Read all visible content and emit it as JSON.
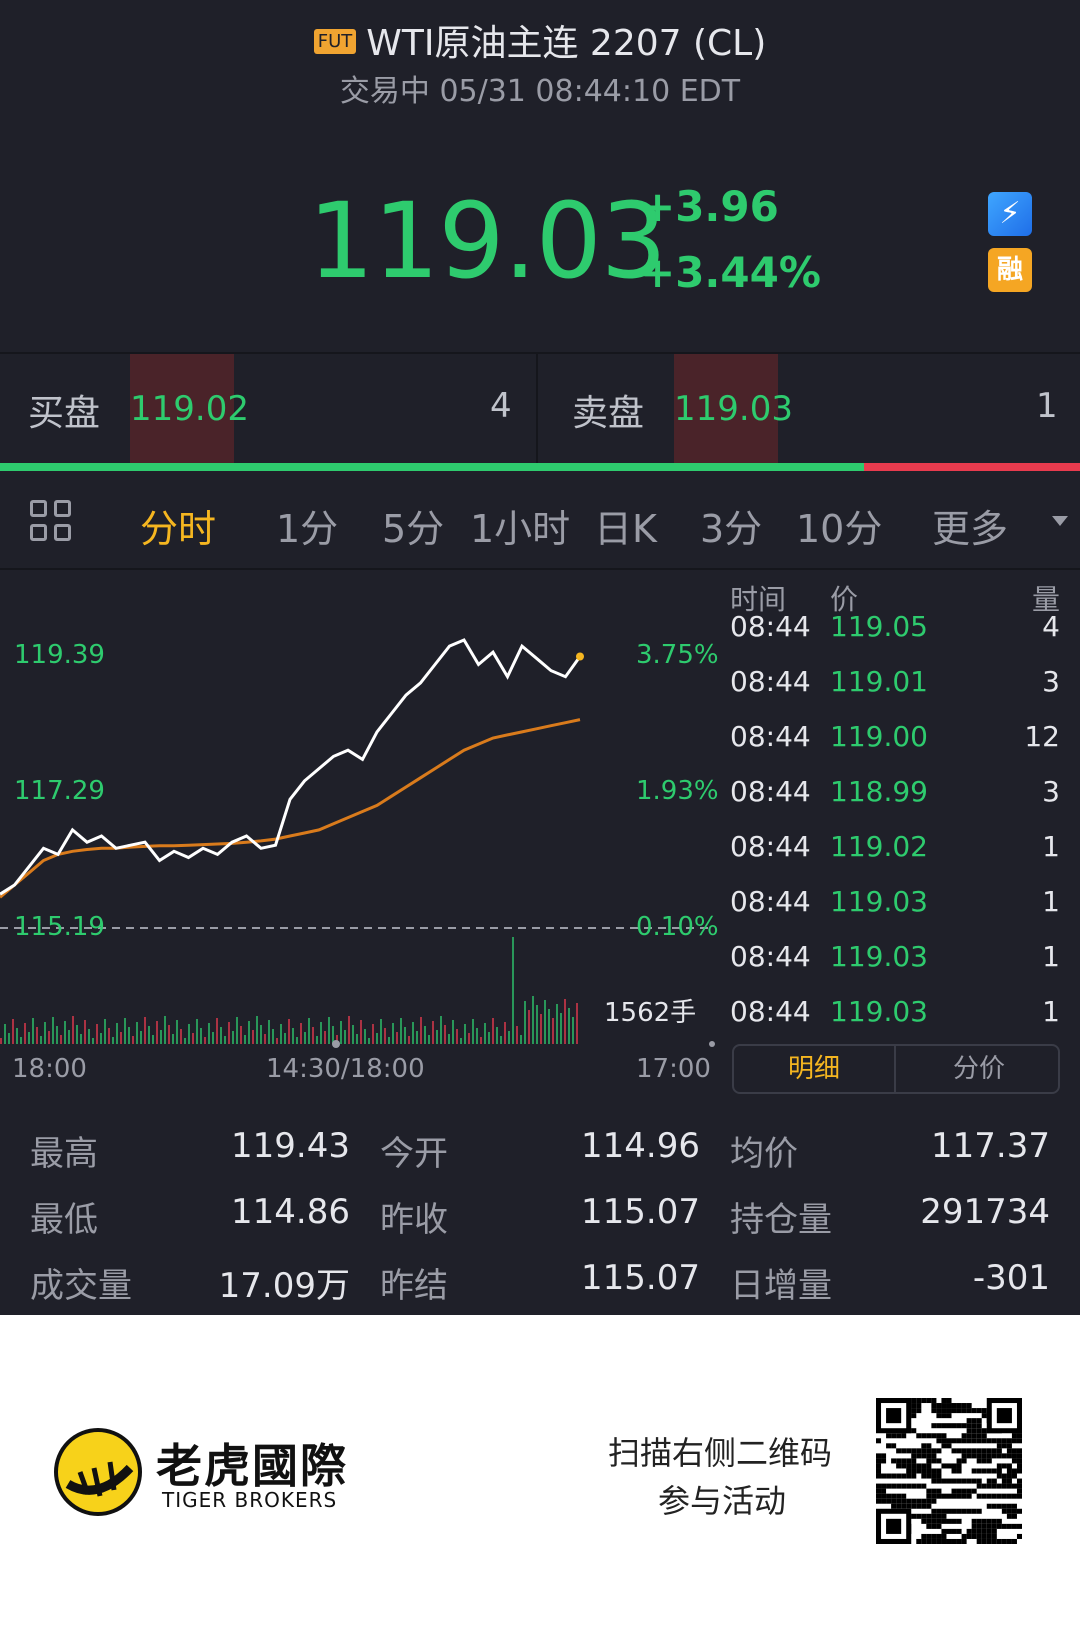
{
  "header": {
    "badge": "FUT",
    "title": "WTI原油主连 2207 (CL)",
    "status": "交易中 05/31 08:44:10 EDT"
  },
  "quote": {
    "price": "119.03",
    "change": "+3.96",
    "change_pct": "+3.44%",
    "bolt_icon_label": "1",
    "rong_label": "融"
  },
  "orderbook": {
    "bid_label": "买盘",
    "bid_price": "119.02",
    "bid_qty": "4",
    "ask_label": "卖盘",
    "ask_price": "119.03",
    "ask_qty": "1",
    "bid_ratio": 0.8
  },
  "tabs": {
    "items": [
      "分时",
      "1分",
      "5分",
      "1小时",
      "日K",
      "3分",
      "10分",
      "更多"
    ],
    "active": "分时"
  },
  "chart": {
    "y_left": [
      "119.39",
      "117.29",
      "115.19"
    ],
    "y_right": [
      "3.75%",
      "1.93%",
      "0.10%"
    ],
    "x_labels": [
      "18:00",
      "14:30/18:00",
      "17:00"
    ],
    "volume_label": "1562手",
    "colors": {
      "price": "#ffffff",
      "avg": "#d97b1c",
      "up": "#2ecb6e",
      "down": "#e83b4e",
      "last_dot": "#f5b620"
    }
  },
  "chart_data": {
    "type": "line",
    "series": [
      {
        "values": [
          115.15,
          115.3,
          115.6,
          115.9,
          115.8,
          116.2,
          116.0,
          116.1,
          115.9,
          115.95,
          116.0,
          115.7,
          115.85,
          115.75,
          115.9,
          115.8,
          116.0,
          116.1,
          115.9,
          115.95,
          116.7,
          117.0,
          117.2,
          117.4,
          117.5,
          117.35,
          117.8,
          118.1,
          118.4,
          118.6,
          118.9,
          119.2,
          119.3,
          118.9,
          119.1,
          118.7,
          119.2,
          119.0,
          118.8,
          118.7,
          119.03
        ]
      },
      {
        "values": [
          115.1,
          115.3,
          115.5,
          115.7,
          115.8,
          115.85,
          115.88,
          115.9,
          115.9,
          115.92,
          115.93,
          115.94,
          115.94,
          115.95,
          115.96,
          115.97,
          115.98,
          116.0,
          116.02,
          116.05,
          116.1,
          116.15,
          116.2,
          116.3,
          116.4,
          116.5,
          116.6,
          116.75,
          116.9,
          117.05,
          117.2,
          117.35,
          117.5,
          117.6,
          117.7,
          117.75,
          117.8,
          117.85,
          117.9,
          117.95,
          118.0
        ]
      }
    ],
    "ylim": [
      114.86,
      119.43
    ],
    "reference": 115.07
  },
  "ticks": {
    "headers": [
      "时间",
      "价",
      "量"
    ],
    "rows": [
      {
        "time": "08:44",
        "price": "119.05",
        "vol": "4"
      },
      {
        "time": "08:44",
        "price": "119.01",
        "vol": "3"
      },
      {
        "time": "08:44",
        "price": "119.00",
        "vol": "12"
      },
      {
        "time": "08:44",
        "price": "118.99",
        "vol": "3"
      },
      {
        "time": "08:44",
        "price": "119.02",
        "vol": "1"
      },
      {
        "time": "08:44",
        "price": "119.03",
        "vol": "1"
      },
      {
        "time": "08:44",
        "price": "119.03",
        "vol": "1"
      },
      {
        "time": "08:44",
        "price": "119.03",
        "vol": "1"
      }
    ],
    "seg_detail": "明细",
    "seg_price": "分价"
  },
  "stats": {
    "high_label": "最高",
    "high": "119.43",
    "open_label": "今开",
    "open": "114.96",
    "avg_label": "均价",
    "avg": "117.37",
    "low_label": "最低",
    "low": "114.86",
    "prev_close_label": "昨收",
    "prev_close": "115.07",
    "oi_label": "持仓量",
    "oi": "291734",
    "volume_label": "成交量",
    "volume": "17.09万",
    "settle_label": "昨结",
    "settle": "115.07",
    "oi_chg_label": "日增量",
    "oi_chg": "-301"
  },
  "footer": {
    "brand_cn": "老虎國際",
    "brand_en": "TIGER BROKERS",
    "promo_line1": "扫描右侧二维码",
    "promo_line2": "参与活动"
  }
}
